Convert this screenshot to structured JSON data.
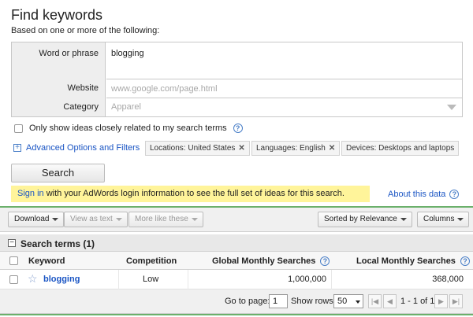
{
  "header": {
    "title": "Find keywords",
    "subtitle": "Based on one or more of the following:"
  },
  "form": {
    "word_label": "Word or phrase",
    "word_value": "blogging",
    "website_label": "Website",
    "website_placeholder": "www.google.com/page.html",
    "category_label": "Category",
    "category_value": "Apparel"
  },
  "options": {
    "closely_related": "Only show ideas closely related to my search terms",
    "advanced_link": "Advanced Options and Filters",
    "chips": [
      {
        "label": "Locations: United States",
        "removable": true
      },
      {
        "label": "Languages: English",
        "removable": true
      },
      {
        "label": "Devices: Desktops and laptops",
        "removable": false
      }
    ]
  },
  "search_button": "Search",
  "banner": {
    "signin_link": "Sign in",
    "text": " with your AdWords login information to see the full set of ideas for this search.",
    "about_link": "About this data"
  },
  "toolbar": {
    "download": "Download",
    "view_as_text": "View as text",
    "more_like_these": "More like these",
    "sorted_by": "Sorted by Relevance",
    "columns": "Columns"
  },
  "results": {
    "section_title": "Search terms (1)",
    "columns": {
      "keyword": "Keyword",
      "competition": "Competition",
      "global": "Global Monthly Searches",
      "local": "Local Monthly Searches"
    },
    "rows": [
      {
        "keyword": "blogging",
        "competition": "Low",
        "global": "1,000,000",
        "local": "368,000"
      }
    ]
  },
  "pager": {
    "go_to_page_label": "Go to page:",
    "page_value": "1",
    "show_rows_label": "Show rows:",
    "rows_value": "50",
    "range": "1 - 1 of 1"
  },
  "colors": {
    "link": "#1a55c4",
    "banner_bg": "#fff49a",
    "accent_green": "#6bb06b"
  }
}
